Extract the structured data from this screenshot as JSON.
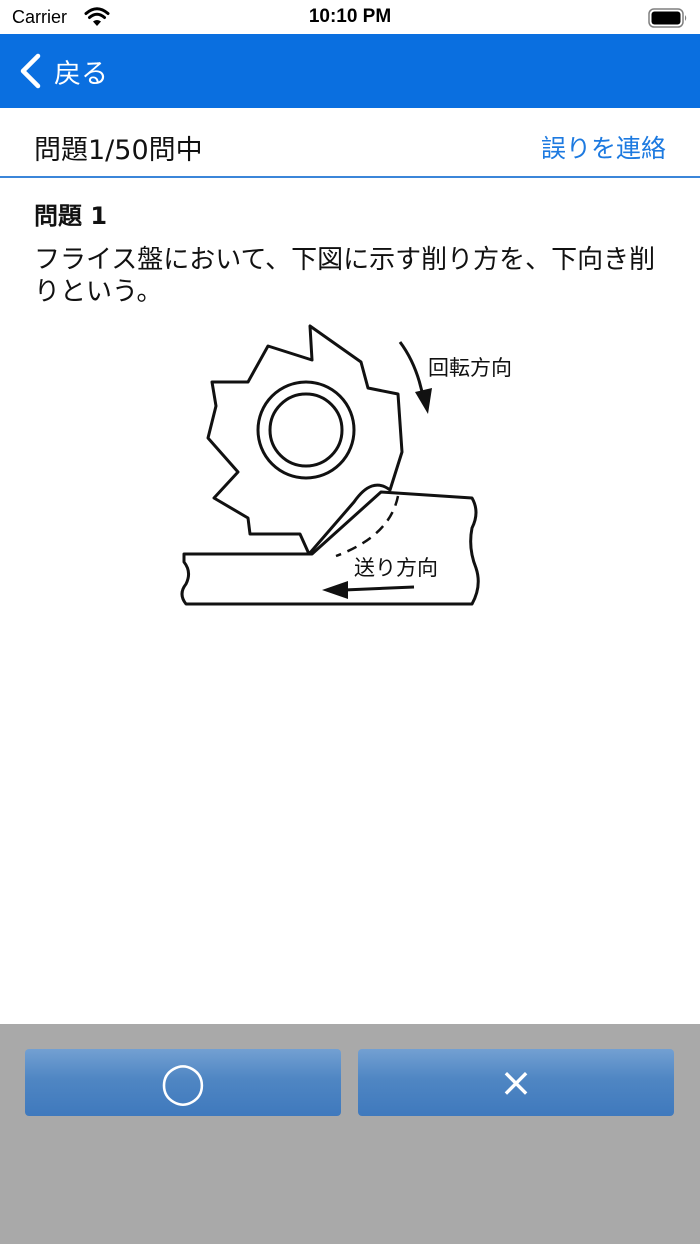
{
  "status_bar": {
    "carrier": "Carrier",
    "time": "10:10 PM"
  },
  "nav": {
    "back_label": "戻る",
    "color": "#0a6fe0"
  },
  "question_header": {
    "progress": "問題1/50問中",
    "report_link": "誤りを連絡"
  },
  "question": {
    "title": "問題 1",
    "text": "フライス盤において、下図に示す削り方を、下向き削りという。",
    "diagram": {
      "rotation_label": "回転方向",
      "feed_label": "送り方向"
    }
  },
  "answers": {
    "correct_label": "◯",
    "wrong_label": "×",
    "area_color": "#a9a9a9"
  }
}
